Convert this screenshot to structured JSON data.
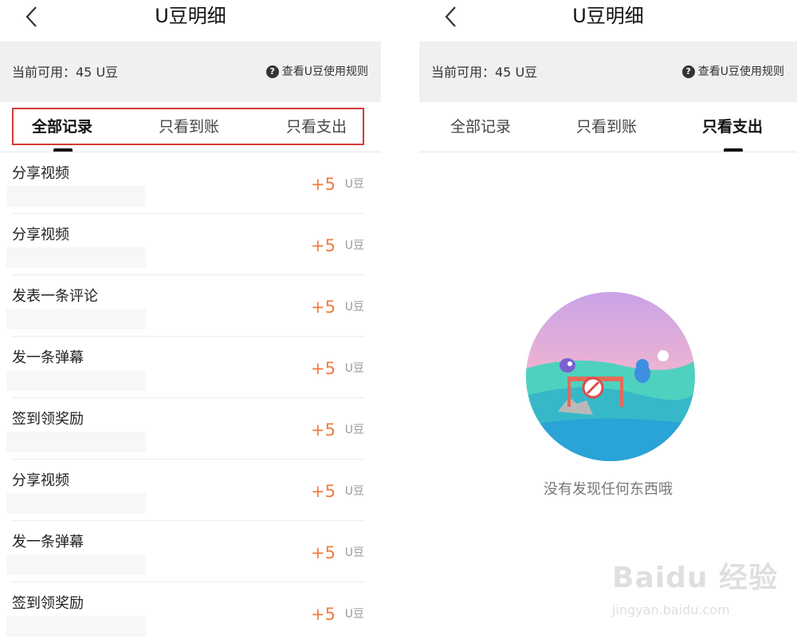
{
  "colors": {
    "accent": "#f07b3f",
    "highlight_border": "#d23a3a",
    "balance_bg": "#f0f0f0"
  },
  "left": {
    "header": {
      "title": "U豆明细",
      "back_icon": "chevron-left-icon"
    },
    "balance": {
      "text": "当前可用：45 U豆",
      "rules_label": "查看U豆使用规则",
      "rules_icon": "question-circle-icon"
    },
    "tabs": [
      {
        "label": "全部记录",
        "active": true
      },
      {
        "label": "只看到账",
        "active": false
      },
      {
        "label": "只看支出",
        "active": false
      }
    ],
    "records": [
      {
        "title": "分享视频",
        "amount": "+5",
        "unit": "U豆"
      },
      {
        "title": "分享视频",
        "amount": "+5",
        "unit": "U豆"
      },
      {
        "title": "发表一条评论",
        "amount": "+5",
        "unit": "U豆"
      },
      {
        "title": "发一条弹幕",
        "amount": "+5",
        "unit": "U豆"
      },
      {
        "title": "签到领奖励",
        "amount": "+5",
        "unit": "U豆"
      },
      {
        "title": "分享视频",
        "amount": "+5",
        "unit": "U豆"
      },
      {
        "title": "发一条弹幕",
        "amount": "+5",
        "unit": "U豆"
      },
      {
        "title": "签到领奖励",
        "amount": "+5",
        "unit": "U豆"
      }
    ]
  },
  "right": {
    "header": {
      "title": "U豆明细",
      "back_icon": "chevron-left-icon"
    },
    "balance": {
      "text": "当前可用：45 U豆",
      "rules_label": "查看U豆使用规则",
      "rules_icon": "question-circle-icon"
    },
    "tabs": [
      {
        "label": "全部记录",
        "active": false
      },
      {
        "label": "只看到账",
        "active": false
      },
      {
        "label": "只看支出",
        "active": true
      }
    ],
    "empty": {
      "message": "没有发现任何东西哦",
      "illustration": "empty-state-illustration"
    }
  },
  "watermark": {
    "brand": "Baidu 经验",
    "url": "jingyan.baidu.com"
  }
}
